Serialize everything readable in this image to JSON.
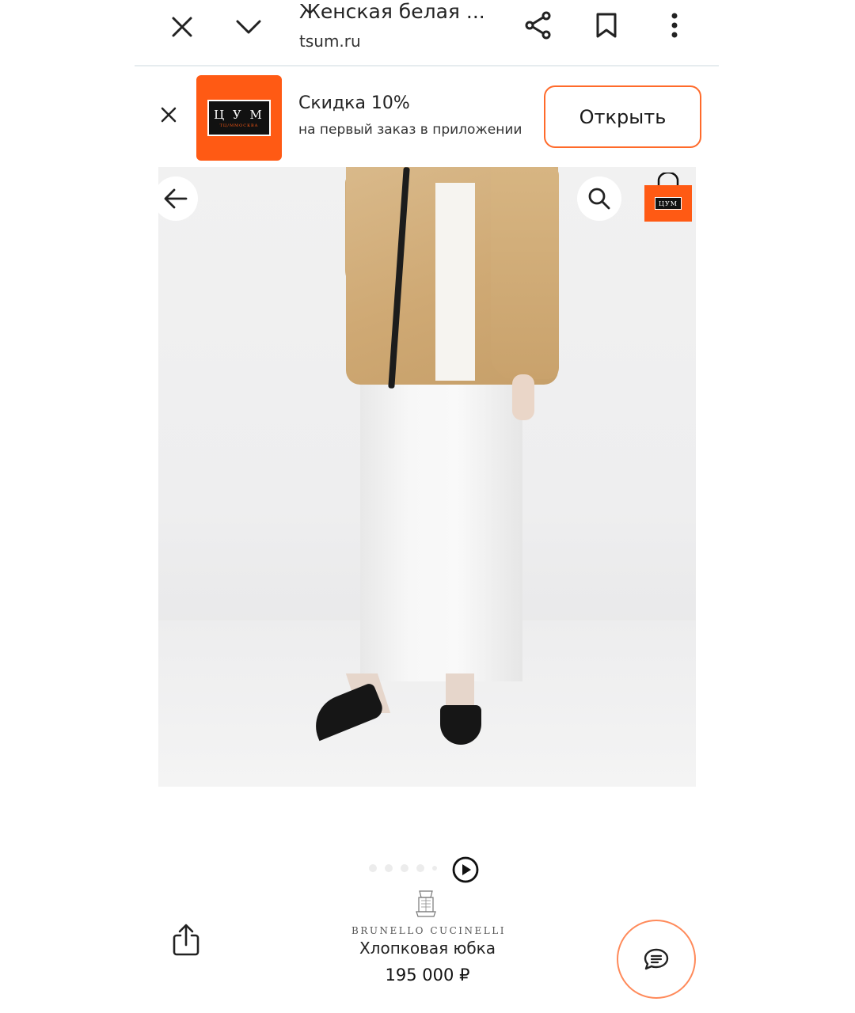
{
  "browser": {
    "page_title": "Женская белая ...",
    "url": "tsum.ru",
    "icons": {
      "close": "close-icon",
      "collapse": "chevron-down-icon",
      "share": "share-icon",
      "bookmark": "bookmark-icon",
      "more": "more-vertical-icon"
    }
  },
  "app_banner": {
    "logo_text": "Ц У М",
    "logo_sub": "ТЦ/ММОСКВА",
    "title": "Скидка 10%",
    "subtitle": "на первый заказ в приложении",
    "open_label": "Открыть",
    "accent_color": "#ff5a14"
  },
  "product_gallery": {
    "icons": {
      "back": "arrow-left-icon",
      "search": "search-icon",
      "bag": "shopping-bag-icon",
      "play": "play-icon"
    },
    "bag_label": "ЦУМ",
    "pager": {
      "total_dots": 5,
      "active_index": 0
    }
  },
  "product": {
    "brand": "BRUNELLO CUCINELLI",
    "name": "Хлопковая юбка",
    "price": "195 000 ₽"
  },
  "actions": {
    "share_icon": "share-up-icon",
    "chat_icon": "chat-icon"
  }
}
